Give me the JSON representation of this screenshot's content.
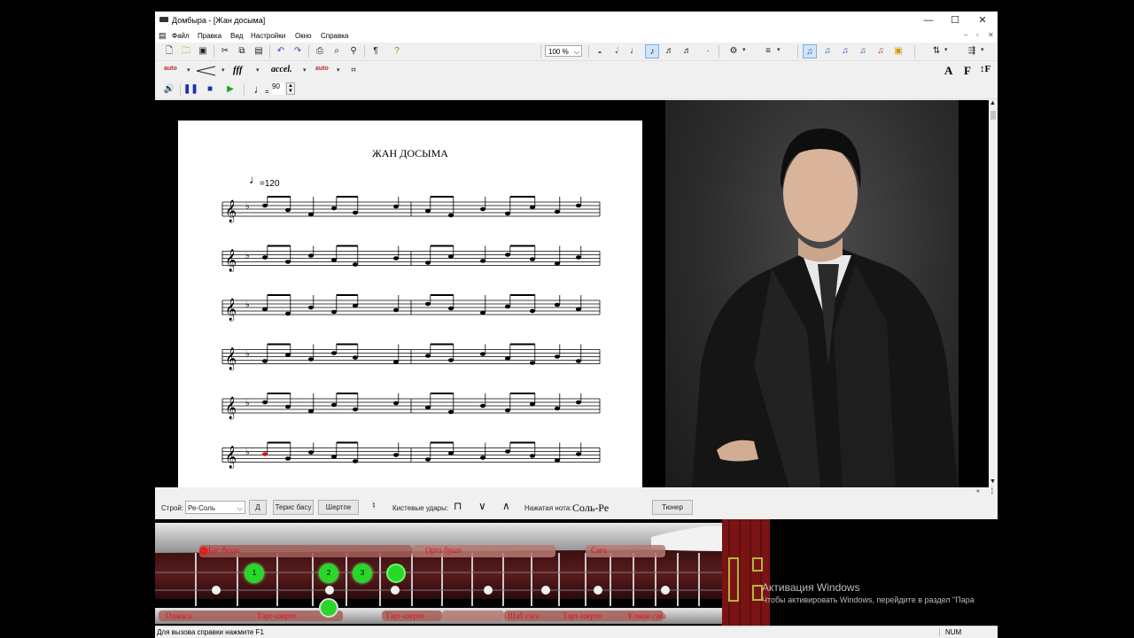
{
  "window": {
    "title": "Домбыра - [Жан досыма]",
    "minimize": "—",
    "maximize": "☐",
    "close": "✕"
  },
  "menu": {
    "items": [
      "Файл",
      "Правка",
      "Вид",
      "Настройки",
      "Окно",
      "Справка"
    ],
    "mdi_controls": [
      "–",
      "▫",
      "✕"
    ]
  },
  "toolbar1": {
    "zoom": "100 %",
    "zoom_arrow": "⌵"
  },
  "toolbar2": {
    "auto1": "auto",
    "auto2": "auto",
    "dynamics": "fff",
    "accel": "accel.",
    "font_a": "A",
    "font_f": "F",
    "font_ff": "↕F"
  },
  "toolbar3": {
    "tempo_value": "90"
  },
  "score": {
    "title": "ЖАН ДОСЫМА",
    "tempo": "=120",
    "staves": 6
  },
  "controls": {
    "tuning_label": "Строй:",
    "tuning_value": "Ре-Соль",
    "d_button": "Д",
    "reverse_button": "Терис басу",
    "shertpe_button": "Шертпе",
    "strokes_label": "Кистевые удары:",
    "pressed_label": "Нажатая нота:",
    "pressed_value": "Соль-Ре",
    "tuner_button": "Тюнер"
  },
  "dombra": {
    "top_labels": [
      "Бас буын",
      "Орта буын",
      "Саға"
    ],
    "bottom_labels": [
      "Олжаса",
      "Тарт-шерте",
      "Тарт-шерте",
      "Шаб саға",
      "Тарт-шерте",
      "Ұлжан саға"
    ],
    "green_dots": [
      "1",
      "2",
      "3",
      ""
    ]
  },
  "status": {
    "help": "Для вызова справки нажмите F1",
    "num": "NUM"
  },
  "watermark": {
    "title": "Активация Windows",
    "subtitle": "Чтобы активировать Windows, перейдите в раздел \"Пара"
  }
}
